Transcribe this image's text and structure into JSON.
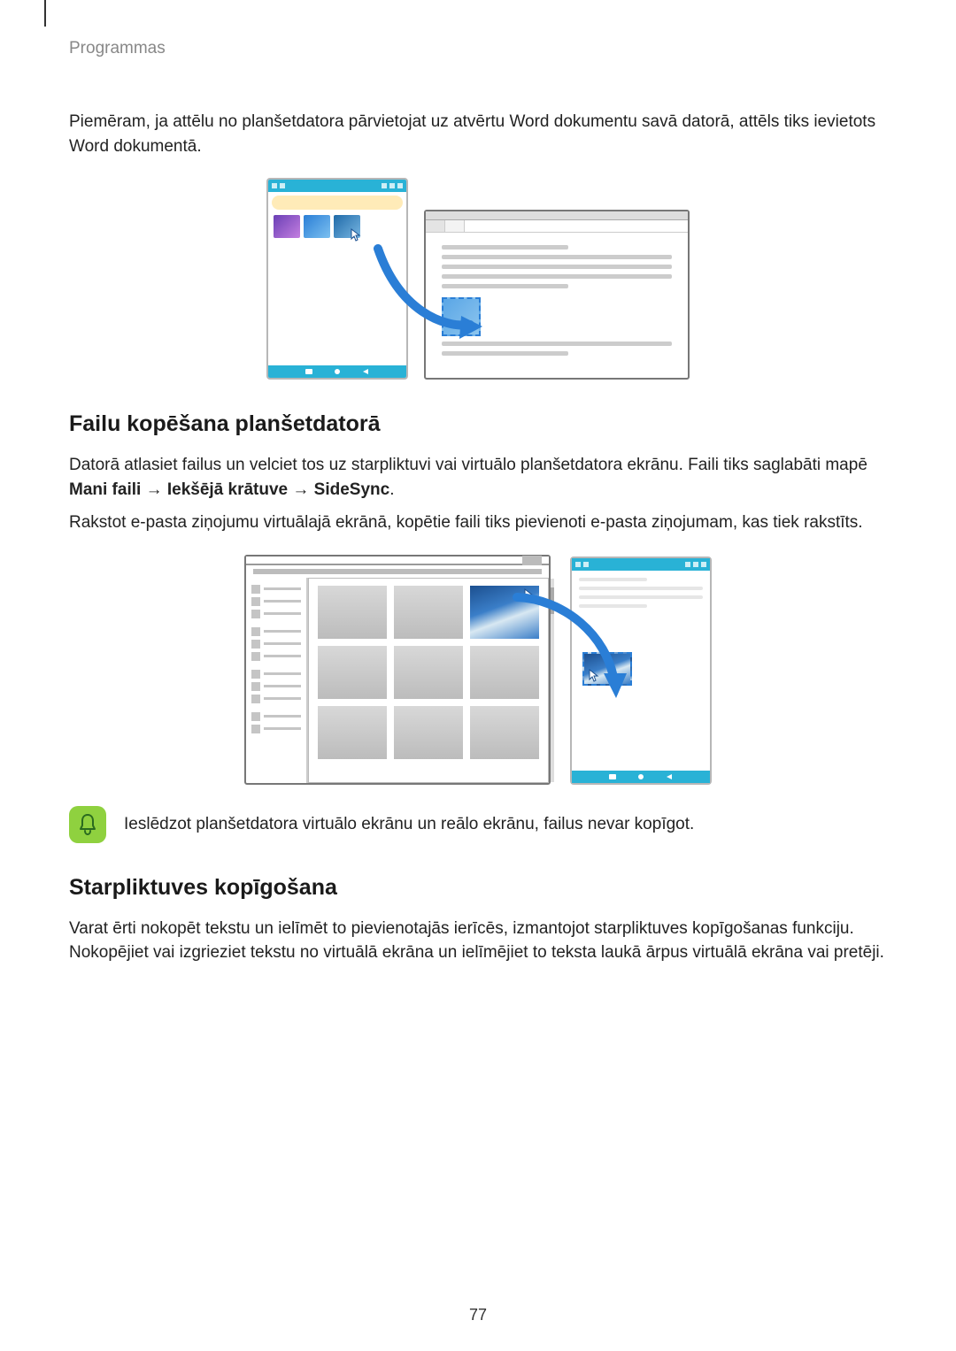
{
  "header": {
    "label": "Programmas"
  },
  "intro": "Piemēram, ja attēlu no planšetdatora pārvietojat uz atvērtu Word dokumentu savā datorā, attēls tiks ievietots Word dokumentā.",
  "section1": {
    "title": "Failu kopēšana planšetdatorā",
    "p1_a": "Datorā atlasiet failus un velciet tos uz starpliktuvi vai virtuālo planšetdatora ekrānu. Faili tiks saglabāti mapē ",
    "p1_bold": "Mani faili → Iekšējā krātuve → SideSync",
    "p1_b": ".",
    "p2": "Rakstot e-pasta ziņojumu virtuālajā ekrānā, kopētie faili tiks pievienoti e-pasta ziņojumam, kas tiek rakstīts."
  },
  "note": "Ieslēdzot planšetdatora virtuālo ekrānu un reālo ekrānu, failus nevar kopīgot.",
  "section2": {
    "title": "Starpliktuves kopīgošana",
    "p1": "Varat ērti nokopēt tekstu un ielīmēt to pievienotajās ierīcēs, izmantojot starpliktuves kopīgošanas funkciju. Nokopējiet vai izgrieziet tekstu no virtuālā ekrāna un ielīmējiet to teksta laukā ārpus virtuālā ekrāna vai pretēji."
  },
  "page_number": "77"
}
